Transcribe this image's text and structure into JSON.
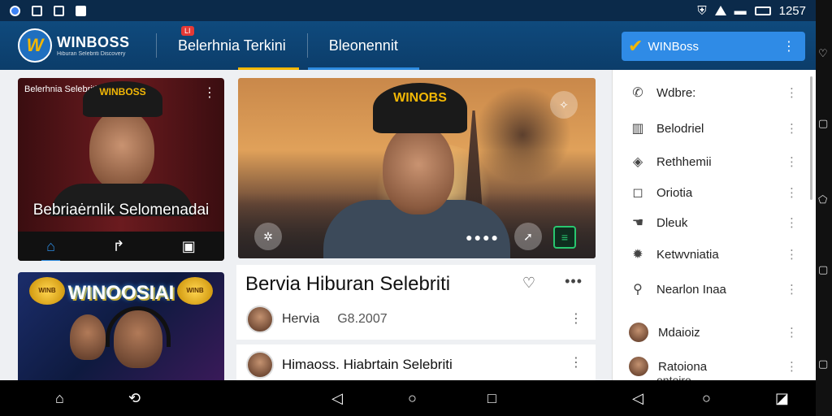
{
  "status_bar": {
    "time": "1257"
  },
  "app_bar": {
    "logo_name": "WINBOSS",
    "logo_tagline": "Hiburan Selebriti Discovery",
    "tab_badge": "LI",
    "tabs": [
      {
        "label": "Belerhnia Terkini"
      },
      {
        "label": "Bleonennit"
      }
    ],
    "brand_pill": "WINBoss"
  },
  "card1": {
    "caption": "Belerhnia Selebriti",
    "hat_text": "WINBOSS",
    "title": "Bebriaėrnlik Selomenadai"
  },
  "card2": {
    "title": "WINOOSIAI",
    "coin_left": "WINB",
    "coin_right": "WINB"
  },
  "hero": {
    "hat_text": "WINOBS"
  },
  "article": {
    "headline": "Bervia  Hiburan Selebriti",
    "author": "Hervia",
    "date": "G8.2007"
  },
  "article2": {
    "headline": "Himaoss. Hiabrtain Selebriti"
  },
  "sidebar": {
    "items": [
      {
        "label": "Wdbre:",
        "icon": "phone-icon"
      },
      {
        "label": "Belodriel",
        "icon": "chart-icon"
      },
      {
        "label": "Rethhemii",
        "icon": "cube-icon"
      },
      {
        "label": "Oriotia",
        "icon": "square-icon"
      },
      {
        "label": "Dleuk",
        "icon": "thumb-icon"
      },
      {
        "label": "Ketwvniatia",
        "icon": "gear-icon"
      },
      {
        "label": "Nearlon Inaa",
        "icon": "search-icon"
      },
      {
        "label": "Mdaioiz",
        "icon": "avatar"
      },
      {
        "label": "Ratoiona",
        "icon": "avatar"
      }
    ],
    "sub_label": "ontoiro"
  },
  "colors": {
    "primary": "#0f4a7d",
    "accent": "#f2b705",
    "highlight": "#2f8be6"
  }
}
